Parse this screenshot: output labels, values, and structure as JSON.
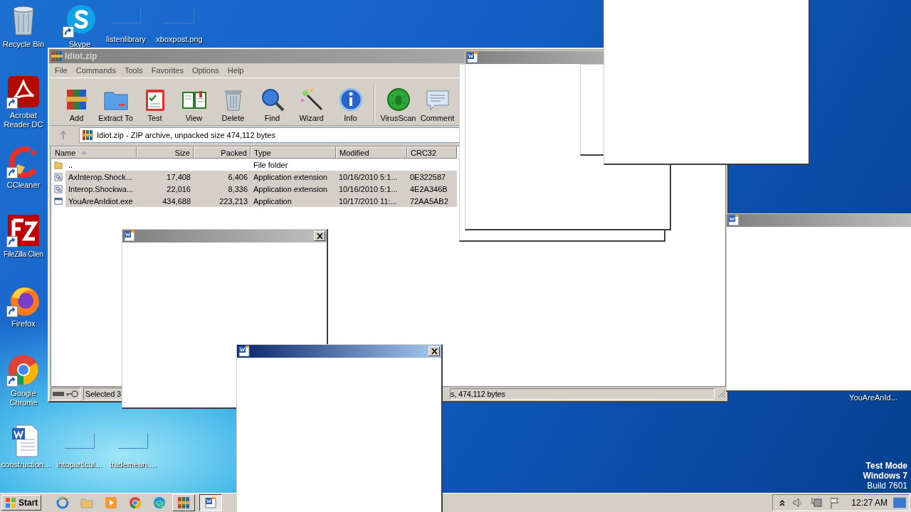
{
  "desktop_icons": [
    {
      "label": "Recycle Bin",
      "kind": "recycle",
      "shortcut": false
    },
    {
      "label": "Skype",
      "kind": "skype",
      "shortcut": true
    },
    {
      "label": "listenlibrary",
      "kind": "blank",
      "shortcut": false
    },
    {
      "label": "xboxpost.png",
      "kind": "blank",
      "shortcut": false
    },
    {
      "label": "Acrobat Reader DC",
      "kind": "acrobat",
      "shortcut": true
    },
    {
      "label": "CCleaner",
      "kind": "ccleaner",
      "shortcut": true
    },
    {
      "label": "FileZilla Clien",
      "kind": "filezilla",
      "shortcut": true
    },
    {
      "label": "Firefox",
      "kind": "firefox",
      "shortcut": true
    },
    {
      "label": "Google Chrome",
      "kind": "chrome",
      "shortcut": true
    },
    {
      "label": "construction…",
      "kind": "word",
      "shortcut": false
    },
    {
      "label": "intoparticul…",
      "kind": "blank",
      "shortcut": false
    },
    {
      "label": "trademean.…",
      "kind": "blank",
      "shortcut": false
    },
    {
      "label": "YouAreAnId...",
      "kind": "none",
      "shortcut": false
    }
  ],
  "archive_window": {
    "title": "Idiot.zip",
    "active": false,
    "menu": [
      "File",
      "Commands",
      "Tools",
      "Favorites",
      "Options",
      "Help"
    ],
    "toolbar": [
      {
        "label": "Add",
        "kind": "add"
      },
      {
        "label": "Extract To",
        "kind": "extract"
      },
      {
        "label": "Test",
        "kind": "test"
      },
      {
        "label": "View",
        "kind": "view"
      },
      {
        "label": "Delete",
        "kind": "delete"
      },
      {
        "label": "Find",
        "kind": "find"
      },
      {
        "label": "Wizard",
        "kind": "wizard"
      },
      {
        "label": "Info",
        "kind": "info"
      },
      {
        "label": "VirusScan",
        "kind": "virus"
      },
      {
        "label": "Comment",
        "kind": "comment"
      }
    ],
    "address": "Idiot.zip - ZIP archive, unpacked size 474,112 bytes",
    "columns": [
      "Name",
      "Size",
      "Packed",
      "Type",
      "Modified",
      "CRC32"
    ],
    "rows": [
      {
        "name": "..",
        "type": "File folder",
        "kind": "folder",
        "selected": false
      },
      {
        "name": "AxInterop.Shock...",
        "size": "17,408",
        "packed": "6,406",
        "type": "Application extension",
        "modified": "10/16/2010 5:1...",
        "crc32": "0E322587",
        "kind": "dll",
        "selected": true
      },
      {
        "name": "Interop.Shockwa...",
        "size": "22,016",
        "packed": "8,336",
        "type": "Application extension",
        "modified": "10/16/2010 5:1...",
        "crc32": "4E2A346B",
        "kind": "dll",
        "selected": true
      },
      {
        "name": "YouAreAnIdiot.exe",
        "size": "434,688",
        "packed": "223,213",
        "type": "Application",
        "modified": "10/17/2010 11:...",
        "crc32": "72AA5AB2",
        "kind": "exe",
        "selected": true
      }
    ],
    "status_left": "Selected 3",
    "status_right": "s, 474,112 bytes"
  },
  "popups": [
    {
      "title_bar": false,
      "close_button": false
    },
    {
      "title_bar": true,
      "active": false,
      "close_button": false
    },
    {
      "title_bar": false,
      "close_button": false
    },
    {
      "title_bar": false,
      "close_button": false
    },
    {
      "title_bar": true,
      "active": false,
      "close_button": false
    },
    {
      "title_bar": true,
      "active": false,
      "close_button": true
    },
    {
      "title_bar": true,
      "active": true,
      "close_button": true
    }
  ],
  "system_notice": [
    {
      "text": "Test Mode",
      "bold": true
    },
    {
      "text": "Windows 7",
      "bold": true
    },
    {
      "text": "Build 7601",
      "bold": false
    }
  ],
  "taskbar": {
    "start": "Start",
    "pinned": [
      {
        "kind": "ie"
      },
      {
        "kind": "explorer"
      },
      {
        "kind": "media"
      },
      {
        "kind": "chrome"
      },
      {
        "kind": "edge"
      }
    ],
    "tasks": [
      {
        "kind": "winrar",
        "selected": false
      },
      {
        "kind": "word",
        "selected": true
      }
    ],
    "tray": [
      {
        "kind": "arrow"
      },
      {
        "kind": "volume"
      },
      {
        "kind": "network"
      },
      {
        "kind": "flag"
      }
    ],
    "clock": "12:27 AM"
  }
}
